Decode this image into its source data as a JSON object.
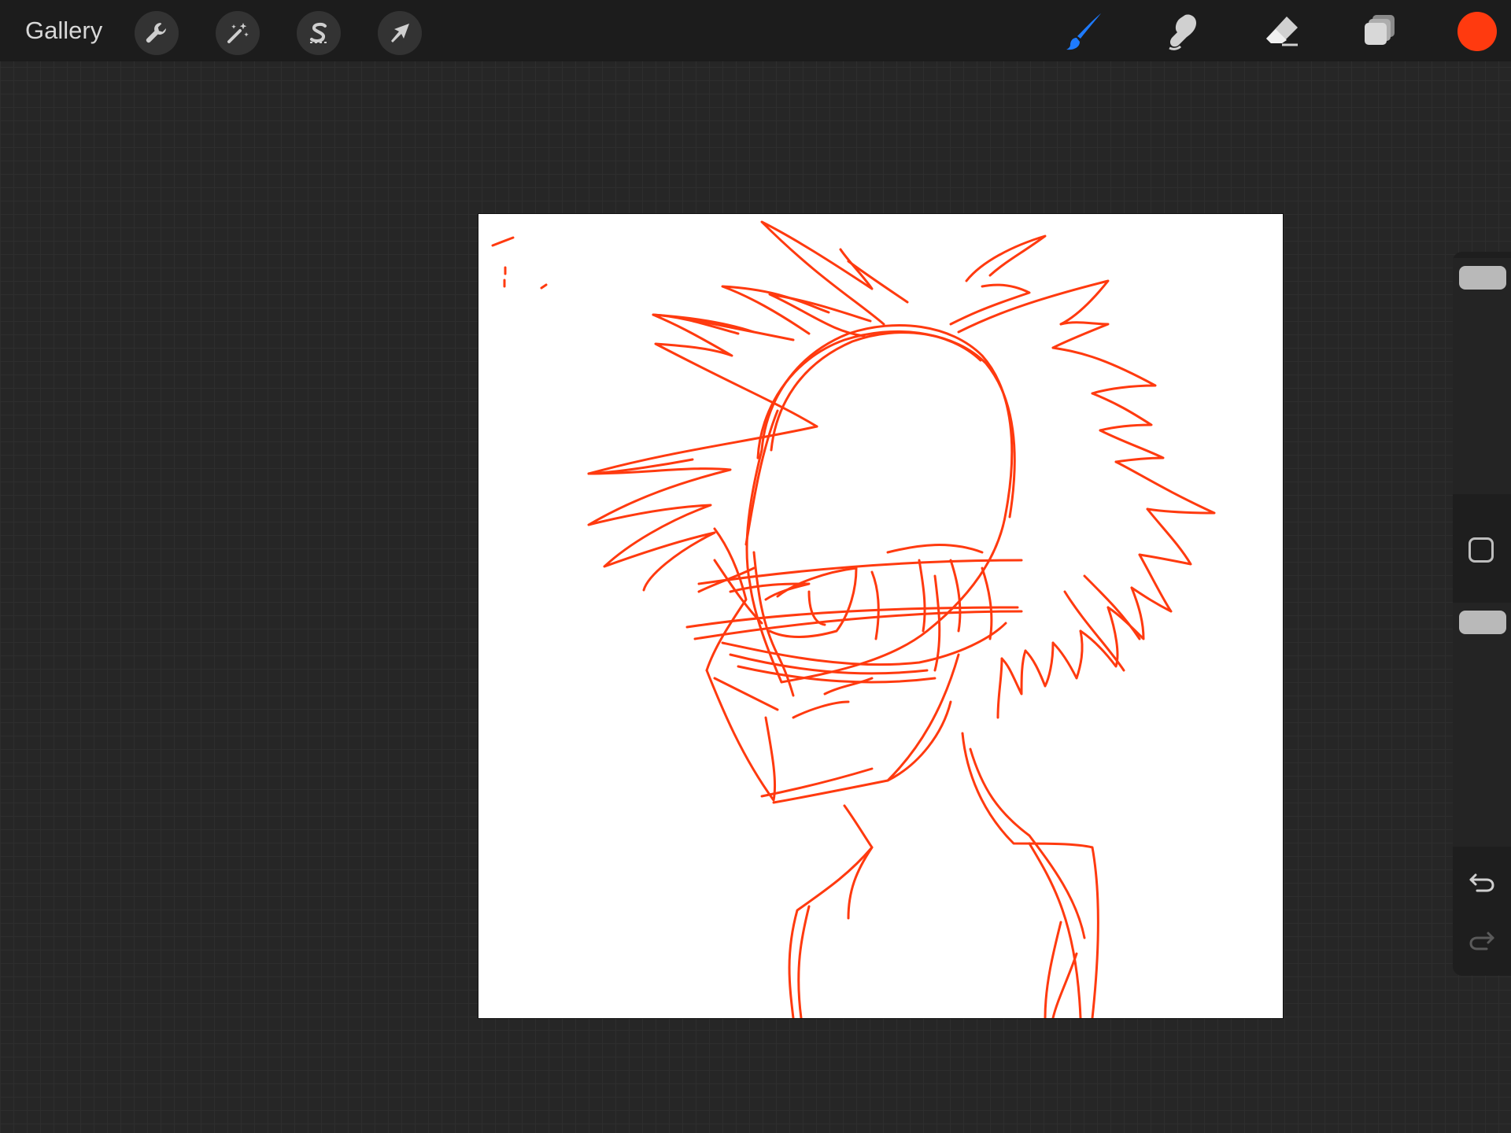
{
  "topbar": {
    "gallery_label": "Gallery",
    "left_tools": [
      {
        "name": "actions",
        "icon": "wrench-icon"
      },
      {
        "name": "adjustments",
        "icon": "magic-wand-icon"
      },
      {
        "name": "selection",
        "icon": "selection-s-icon"
      },
      {
        "name": "transform",
        "icon": "arrow-cursor-icon"
      }
    ],
    "right_tools": [
      {
        "name": "brush",
        "icon": "brush-icon",
        "active": true
      },
      {
        "name": "smudge",
        "icon": "smudge-finger-icon"
      },
      {
        "name": "eraser",
        "icon": "eraser-icon"
      },
      {
        "name": "layers",
        "icon": "layers-icon"
      }
    ],
    "current_color": "#ff3a0f"
  },
  "colors": {
    "active_tool": "#1e7bff",
    "stroke": "#ff3a0f",
    "canvas": "#ffffff"
  },
  "sidebar": {
    "brush_size_level": 0.0,
    "brush_opacity_level": 0.0,
    "buttons": [
      {
        "name": "modify",
        "icon": "modify-square-icon"
      },
      {
        "name": "undo",
        "icon": "undo-icon"
      },
      {
        "name": "redo",
        "icon": "redo-icon",
        "disabled": true
      }
    ]
  }
}
